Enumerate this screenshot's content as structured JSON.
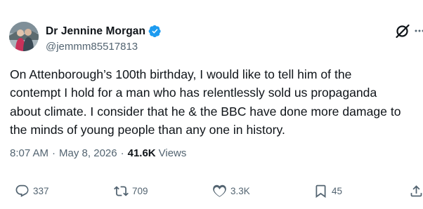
{
  "author": {
    "display_name": "Dr Jennine Morgan",
    "handle": "@jemmm85517813",
    "verified": true,
    "verified_color": "#1d9bf0"
  },
  "tweet": {
    "text": "On Attenborough’s 100th birthday, I would like to tell him of the\ncontempt I hold for a man who has relentlessly sold us propaganda\nabout climate. I consider that he & the BBC have done more damage to\nthe minds of young people than any one in history.",
    "time": "8:07 AM",
    "date": "May 8, 2026",
    "separator": "·",
    "views_count": "41.6K",
    "views_label": "Views"
  },
  "actions": {
    "replies": "337",
    "retweets": "709",
    "likes": "3.3K",
    "bookmarks": "45"
  },
  "icons": {
    "header": [
      "grok-icon",
      "more-icon"
    ],
    "actions": [
      "reply-icon",
      "retweet-icon",
      "like-icon",
      "bookmark-icon",
      "share-icon"
    ]
  },
  "colors": {
    "text": "#0f1419",
    "secondary": "#536471",
    "background": "#ffffff"
  }
}
